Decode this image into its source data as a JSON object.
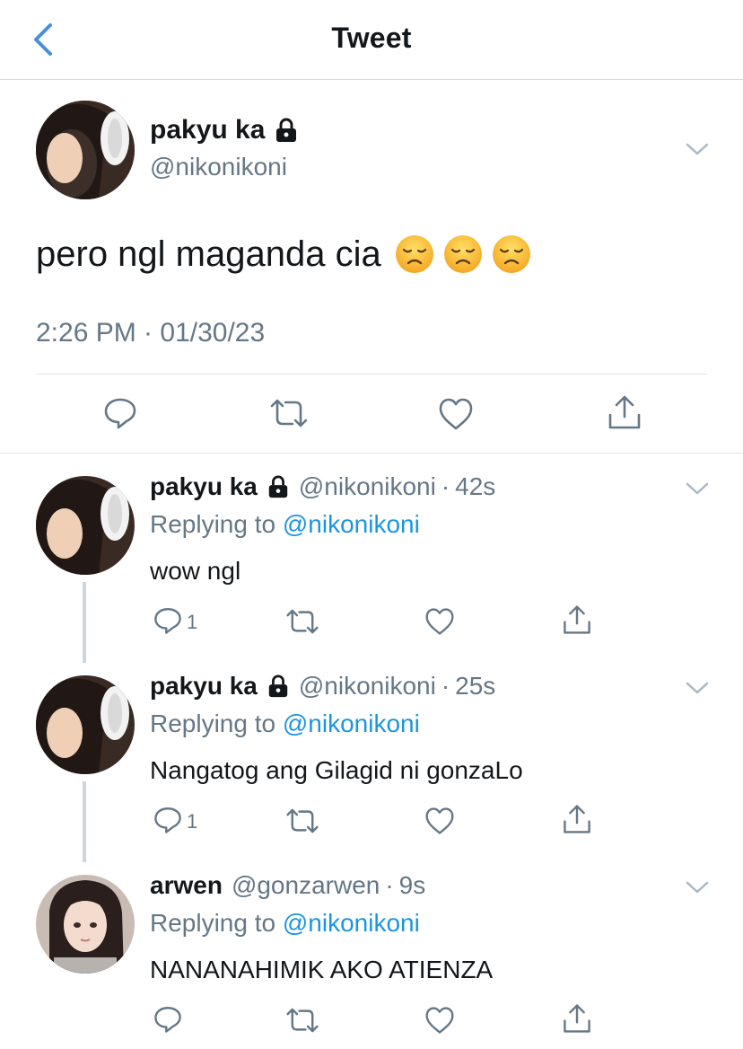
{
  "header": {
    "title": "Tweet"
  },
  "main_tweet": {
    "author_name": "pakyu ka",
    "handle": "@nikonikoni",
    "text": "pero ngl maganda cia",
    "emoji_count": 3,
    "timestamp": "2:26 PM · 01/30/23"
  },
  "replies": [
    {
      "author_name": "pakyu ka",
      "protected": true,
      "handle": "@nikonikoni",
      "dot": "·",
      "time": "42s",
      "replying_prefix": "Replying to",
      "replying_to": "@nikonikoni",
      "text": "wow ngl",
      "reply_count": "1"
    },
    {
      "author_name": "pakyu ka",
      "protected": true,
      "handle": "@nikonikoni",
      "dot": "·",
      "time": "25s",
      "replying_prefix": "Replying to",
      "replying_to": "@nikonikoni",
      "text": "Nangatog ang Gilagid ni gonzaLo",
      "reply_count": "1"
    },
    {
      "author_name": "arwen",
      "protected": false,
      "handle": "@gonzarwen",
      "dot": "·",
      "time": "9s",
      "replying_prefix": "Replying to",
      "replying_to": "@nikonikoni",
      "text": "NANANAHIMIK AKO ATIENZA",
      "reply_count": ""
    }
  ],
  "colors": {
    "accent": "#1b95e0",
    "secondary_text": "#657786",
    "back_arrow": "#4a90d9"
  },
  "icons": [
    "back-chevron-icon",
    "lock-icon",
    "chevron-down-icon",
    "disappointed-face-emoji",
    "reply-icon",
    "retweet-icon",
    "like-icon",
    "share-icon"
  ]
}
